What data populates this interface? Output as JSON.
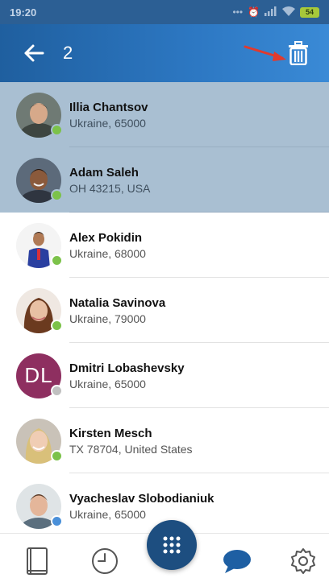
{
  "status_bar": {
    "time": "19:20",
    "icons": [
      "dots-icon",
      "alarm-icon",
      "signal-icon",
      "wifi-icon"
    ],
    "battery": "54"
  },
  "app_bar": {
    "selected_count": "2",
    "accent": "#2d78c3"
  },
  "contacts": [
    {
      "name": "Illia Chantsov",
      "address": "Ukraine, 65000",
      "selected": true,
      "status": "#7cc24a",
      "avatar": "photo"
    },
    {
      "name": "Adam Saleh",
      "address": "OH 43215, USA",
      "selected": true,
      "status": "#7cc24a",
      "avatar": "photo"
    },
    {
      "name": "Alex Pokidin",
      "address": "Ukraine, 68000",
      "selected": false,
      "status": "#7cc24a",
      "avatar": "photo"
    },
    {
      "name": "Natalia Savinova",
      "address": "Ukraine, 79000",
      "selected": false,
      "status": "#7cc24a",
      "avatar": "photo"
    },
    {
      "name": "Dmitri Lobashevsky",
      "address": "Ukraine, 65000",
      "selected": false,
      "status": "#c0c0c0",
      "avatar": "initials",
      "initials": "DL",
      "avatar_color": "#8e2f60"
    },
    {
      "name": "Kirsten Mesch",
      "address": "TX  78704, United States",
      "selected": false,
      "status": "#7cc24a",
      "avatar": "photo"
    },
    {
      "name": "Vyacheslav Slobodianiuk",
      "address": "Ukraine, 65000",
      "selected": false,
      "status": "#4a90d9",
      "avatar": "photo"
    }
  ],
  "bottom_nav": {
    "items": [
      "contacts-book-icon",
      "clock-icon",
      "dialpad-icon",
      "chat-bubble-icon",
      "gear-icon"
    ],
    "active": "chat-bubble-icon",
    "active_color": "#1e5fa3"
  }
}
